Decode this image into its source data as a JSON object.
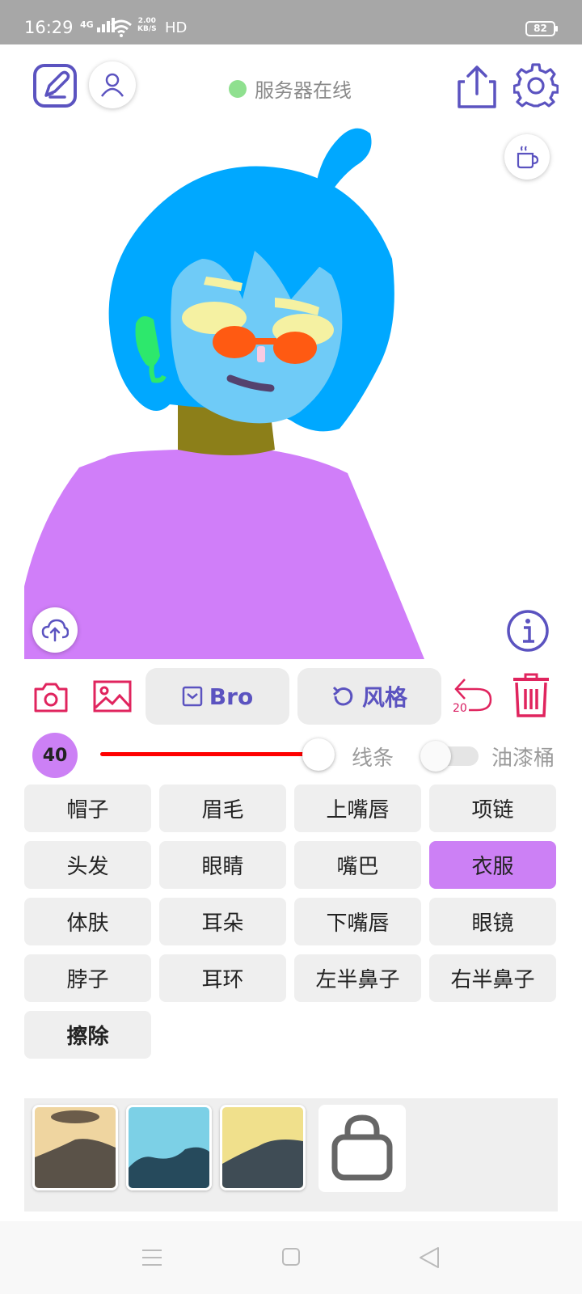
{
  "status_bar": {
    "time": "16:29",
    "signal": "4G",
    "net_speed_value": "2.00",
    "net_speed_unit": "KB/S",
    "hd": "HD",
    "battery": "82"
  },
  "header": {
    "server_status": "服务器在线",
    "server_status_color": "#8fe08f",
    "accent_color": "#5b53c0"
  },
  "toolbar": {
    "style_pill_label": "Bro",
    "style_button_label": "风格",
    "undo_count": "20",
    "danger_color": "#e0245e"
  },
  "brush": {
    "size": "40",
    "line_label": "线条",
    "bucket_label": "油漆桶",
    "slider_fraction": 0.97
  },
  "parts": [
    {
      "label": "帽子"
    },
    {
      "label": "眉毛"
    },
    {
      "label": "上嘴唇"
    },
    {
      "label": "项链"
    },
    {
      "label": "头发"
    },
    {
      "label": "眼睛"
    },
    {
      "label": "嘴巴"
    },
    {
      "label": "衣服",
      "active": true
    },
    {
      "label": "体肤"
    },
    {
      "label": "耳朵"
    },
    {
      "label": "下嘴唇"
    },
    {
      "label": "眼镜"
    },
    {
      "label": "脖子"
    },
    {
      "label": "耳环"
    },
    {
      "label": "左半鼻子"
    },
    {
      "label": "右半鼻子"
    },
    {
      "label": "擦除",
      "bold": true
    }
  ],
  "active_color": "#cc80f5",
  "style_thumbnails": [
    "style-1",
    "style-2",
    "style-3",
    "locked"
  ]
}
